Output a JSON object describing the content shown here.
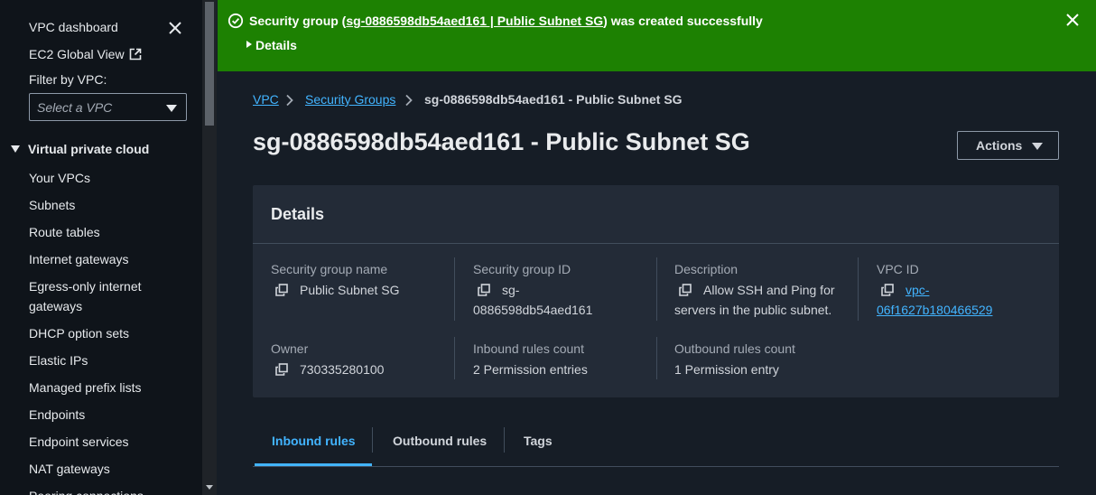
{
  "sidebar": {
    "dashboard": "VPC dashboard",
    "ec2_global_view": "EC2 Global View",
    "filter_label": "Filter by VPC:",
    "filter_placeholder": "Select a VPC",
    "section_title": "Virtual private cloud",
    "items": [
      {
        "label": "Your VPCs"
      },
      {
        "label": "Subnets"
      },
      {
        "label": "Route tables"
      },
      {
        "label": "Internet gateways"
      },
      {
        "label": "Egress-only internet gateways"
      },
      {
        "label": "DHCP option sets"
      },
      {
        "label": "Elastic IPs"
      },
      {
        "label": "Managed prefix lists"
      },
      {
        "label": "Endpoints"
      },
      {
        "label": "Endpoint services"
      },
      {
        "label": "NAT gateways"
      },
      {
        "label": "Peering connections"
      }
    ]
  },
  "flash": {
    "prefix": "Security group (",
    "link": "sg-0886598db54aed161 | Public Subnet SG",
    "suffix": ") was created successfully",
    "details_label": "Details",
    "color": "#1d8102"
  },
  "breadcrumb": {
    "vpc": "VPC",
    "security_groups": "Security Groups",
    "current": "sg-0886598db54aed161 - Public Subnet SG"
  },
  "page": {
    "title": "sg-0886598db54aed161 - Public Subnet SG",
    "actions_label": "Actions"
  },
  "details": {
    "header": "Details",
    "sg_name_label": "Security group name",
    "sg_name": "Public Subnet SG",
    "sg_id_label": "Security group ID",
    "sg_id_line1": "sg-",
    "sg_id_line2": "0886598db54aed161",
    "description_label": "Description",
    "description_line1": "Allow SSH and Ping for",
    "description_line2": "servers in the public subnet.",
    "vpc_id_label": "VPC ID",
    "vpc_id_line1": "vpc-",
    "vpc_id_line2": "06f1627b180466529",
    "owner_label": "Owner",
    "owner": "730335280100",
    "inbound_count_label": "Inbound rules count",
    "inbound_count": "2 Permission entries",
    "outbound_count_label": "Outbound rules count",
    "outbound_count": "1 Permission entry"
  },
  "tabs": [
    {
      "label": "Inbound rules"
    },
    {
      "label": "Outbound rules"
    },
    {
      "label": "Tags"
    }
  ],
  "colors": {
    "accent": "#42b4ff",
    "success": "#1d8102",
    "background": "#161d26",
    "sidebar": "#0f141a",
    "card": "#232b37"
  }
}
